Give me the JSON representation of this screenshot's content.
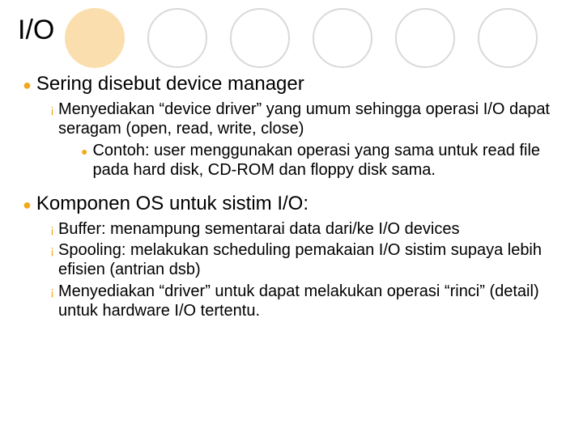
{
  "title": "I/O",
  "sections": [
    {
      "heading": "Sering disebut device manager",
      "items": [
        {
          "text": "Menyediakan “device driver” yang umum sehingga operasi I/O dapat seragam (open, read, write, close)",
          "sub": [
            {
              "text": "Contoh: user menggunakan operasi yang sama untuk read file pada hard disk, CD-ROM dan floppy disk sama."
            }
          ]
        }
      ]
    },
    {
      "heading": "Komponen OS untuk sistim I/O:",
      "items": [
        {
          "text": "Buffer: menampung sementarai data dari/ke I/O devices"
        },
        {
          "text": "Spooling: melakukan scheduling pemakaian I/O sistim supaya lebih efisien (antrian dsb)"
        },
        {
          "text": "Menyediakan “driver” untuk dapat melakukan operasi “rinci” (detail) untuk hardware I/O tertentu."
        }
      ]
    }
  ]
}
